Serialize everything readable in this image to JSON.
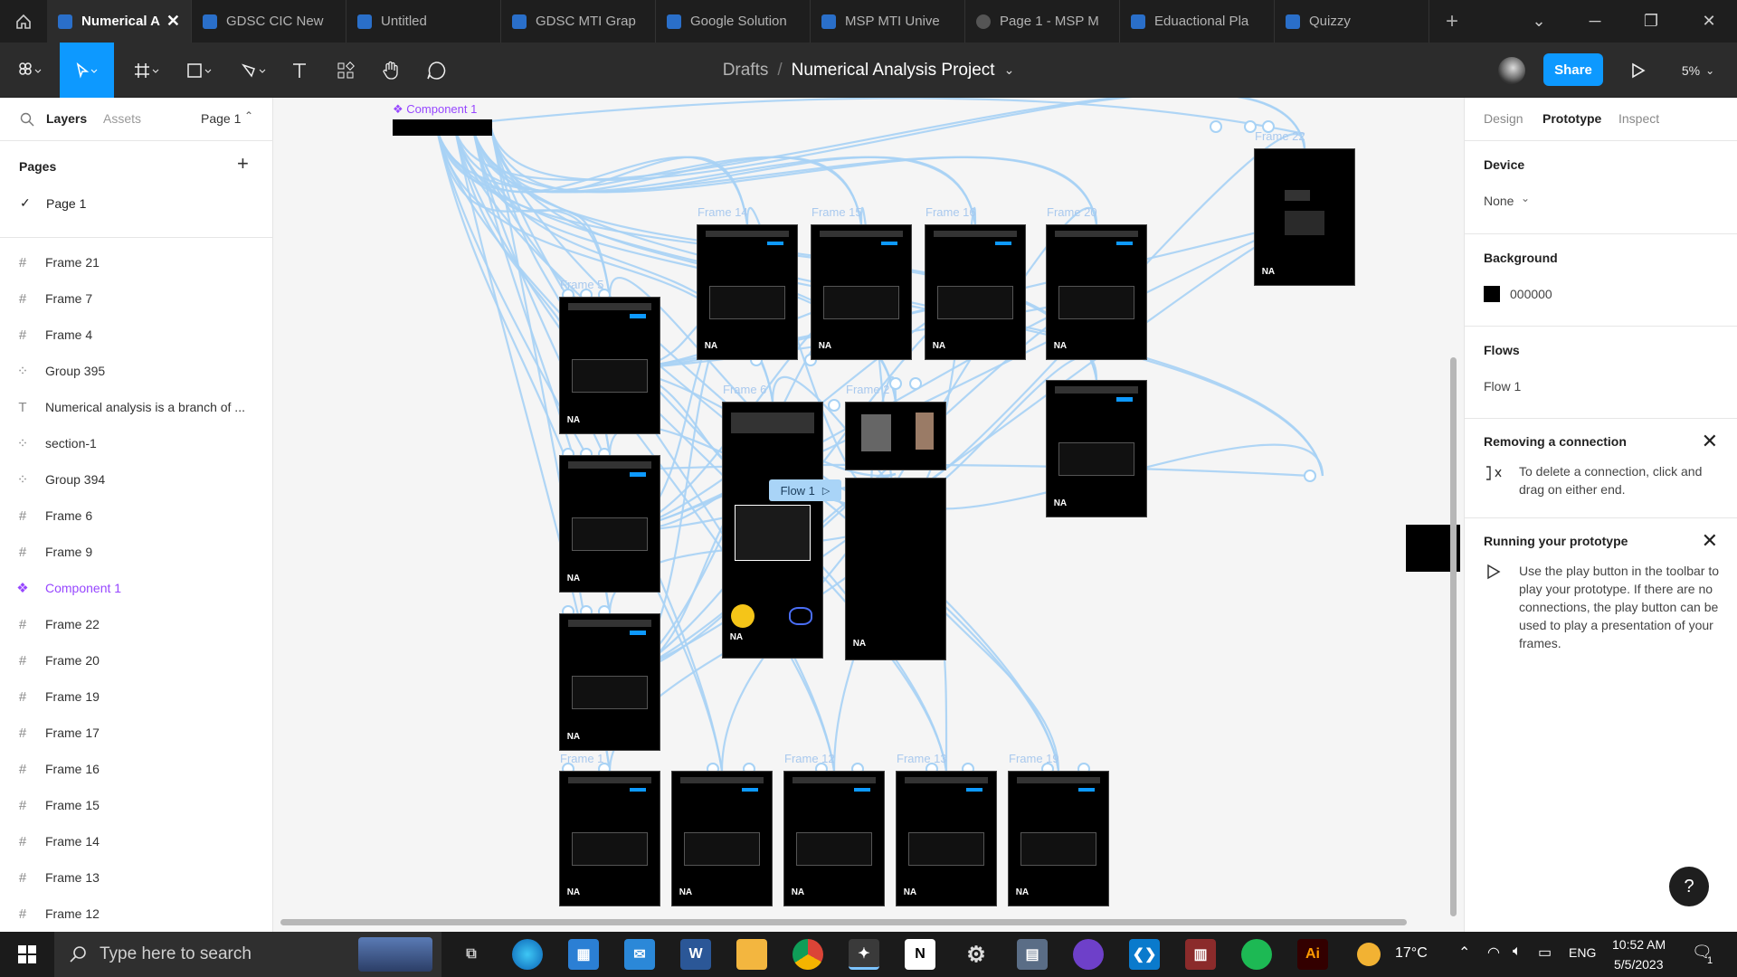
{
  "tabs": [
    {
      "label": "Numerical An",
      "active": true
    },
    {
      "label": "GDSC CIC New"
    },
    {
      "label": "Untitled"
    },
    {
      "label": "GDSC MTI Grap"
    },
    {
      "label": "Google Solution"
    },
    {
      "label": "MSP MTI Unive"
    },
    {
      "label": "Page 1 - MSP M",
      "icon": "play"
    },
    {
      "label": "Eduactional Pla"
    },
    {
      "label": "Quizzy"
    }
  ],
  "header": {
    "drafts": "Drafts",
    "sep": "/",
    "project": "Numerical Analysis Project",
    "share": "Share",
    "zoom": "5%"
  },
  "left_panel": {
    "tab_layers": "Layers",
    "tab_assets": "Assets",
    "page_select": "Page 1",
    "pages_title": "Pages",
    "current_page": "Page 1",
    "layers": [
      {
        "label": "Frame 21",
        "icon": "frame"
      },
      {
        "label": "Frame 7",
        "icon": "frame"
      },
      {
        "label": "Frame 4",
        "icon": "frame"
      },
      {
        "label": "Group 395",
        "icon": "group"
      },
      {
        "label": "Numerical analysis is a branch of ...",
        "icon": "text"
      },
      {
        "label": "section-1",
        "icon": "group"
      },
      {
        "label": "Group 394",
        "icon": "group"
      },
      {
        "label": "Frame 6",
        "icon": "frame"
      },
      {
        "label": "Frame 9",
        "icon": "frame"
      },
      {
        "label": "Component 1",
        "icon": "component"
      },
      {
        "label": "Frame 22",
        "icon": "frame"
      },
      {
        "label": "Frame 20",
        "icon": "frame"
      },
      {
        "label": "Frame 19",
        "icon": "frame"
      },
      {
        "label": "Frame 17",
        "icon": "frame"
      },
      {
        "label": "Frame 16",
        "icon": "frame"
      },
      {
        "label": "Frame 15",
        "icon": "frame"
      },
      {
        "label": "Frame 14",
        "icon": "frame"
      },
      {
        "label": "Frame 13",
        "icon": "frame"
      },
      {
        "label": "Frame 12",
        "icon": "frame"
      }
    ]
  },
  "canvas": {
    "component_label": "Component 1",
    "flow_label": "Flow 1",
    "frames": {
      "f22": "Frame 22",
      "f14": "Frame 14",
      "f15": "Frame 15",
      "f16": "Frame 16",
      "f20": "Frame 20",
      "f5": "Frame 5",
      "f6": "Frame 6",
      "f1": "Frame 1",
      "f12": "Frame 12",
      "f13": "Frame 13",
      "f19": "Frame 19",
      "f2": "Frame 2"
    },
    "frame_logo": "NA"
  },
  "right_panel": {
    "tabs": [
      "Design",
      "Prototype",
      "Inspect"
    ],
    "active_tab": "Prototype",
    "device_title": "Device",
    "device_value": "None",
    "background_title": "Background",
    "background_hex": "000000",
    "flows_title": "Flows",
    "flow_item": "Flow 1",
    "removing_title": "Removing a connection",
    "removing_body": "To delete a connection, click and drag on either end.",
    "running_title": "Running your prototype",
    "running_body": "Use the play button in the toolbar to play your prototype. If there are no connections, the play button can be used to play a presentation of your frames.",
    "help": "?"
  },
  "taskbar": {
    "search_placeholder": "Type here to search",
    "temperature": "17°C",
    "language": "ENG",
    "time": "10:52 AM",
    "date": "5/5/2023",
    "notif": "1"
  },
  "colors": {
    "accent": "#0d99ff",
    "connection": "#a7d2f5",
    "component": "#9747ff",
    "frame_bg": "#000000"
  }
}
